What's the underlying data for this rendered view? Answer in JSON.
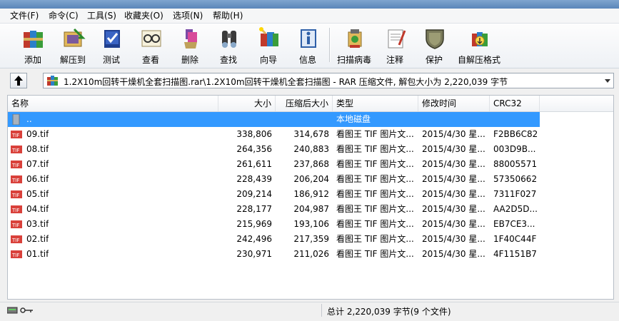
{
  "menu": [
    "文件(F)",
    "命令(C)",
    "工具(S)",
    "收藏夹(O)",
    "选项(N)",
    "帮助(H)"
  ],
  "toolbar": [
    {
      "label": "添加",
      "icon": "books-add-icon"
    },
    {
      "label": "解压到",
      "icon": "folder-extract-icon"
    },
    {
      "label": "测试",
      "icon": "test-book-icon"
    },
    {
      "label": "查看",
      "icon": "glasses-view-icon"
    },
    {
      "label": "删除",
      "icon": "recycle-delete-icon"
    },
    {
      "label": "查找",
      "icon": "binoculars-find-icon"
    },
    {
      "label": "向导",
      "icon": "wizard-icon"
    },
    {
      "label": "信息",
      "icon": "info-icon"
    },
    {
      "label": "扫描病毒",
      "icon": "virus-scan-icon"
    },
    {
      "label": "注释",
      "icon": "comment-icon"
    },
    {
      "label": "保护",
      "icon": "shield-protect-icon"
    },
    {
      "label": "自解压格式",
      "icon": "sfx-icon"
    }
  ],
  "address": "1.2X10m回转干燥机全套扫描图.rar\\1.2X10m回转干燥机全套扫描图 - RAR 压缩文件, 解包大小为 2,220,039 字节",
  "columns": {
    "name": "名称",
    "size": "大小",
    "packed": "压缩后大小",
    "type": "类型",
    "modified": "修改时间",
    "crc": "CRC32"
  },
  "parent_row": {
    "name": "..",
    "type": "本地磁盘"
  },
  "files": [
    {
      "name": "09.tif",
      "size": "338,806",
      "packed": "314,678",
      "type": "看图王 TIF 图片文...",
      "modified": "2015/4/30 星...",
      "crc": "F2BB6C82"
    },
    {
      "name": "08.tif",
      "size": "264,356",
      "packed": "240,883",
      "type": "看图王 TIF 图片文...",
      "modified": "2015/4/30 星...",
      "crc": "003D9B..."
    },
    {
      "name": "07.tif",
      "size": "261,611",
      "packed": "237,868",
      "type": "看图王 TIF 图片文...",
      "modified": "2015/4/30 星...",
      "crc": "88005571"
    },
    {
      "name": "06.tif",
      "size": "228,439",
      "packed": "206,204",
      "type": "看图王 TIF 图片文...",
      "modified": "2015/4/30 星...",
      "crc": "57350662"
    },
    {
      "name": "05.tif",
      "size": "209,214",
      "packed": "186,912",
      "type": "看图王 TIF 图片文...",
      "modified": "2015/4/30 星...",
      "crc": "7311F027"
    },
    {
      "name": "04.tif",
      "size": "228,177",
      "packed": "204,987",
      "type": "看图王 TIF 图片文...",
      "modified": "2015/4/30 星...",
      "crc": "AA2D5D..."
    },
    {
      "name": "03.tif",
      "size": "215,969",
      "packed": "193,106",
      "type": "看图王 TIF 图片文...",
      "modified": "2015/4/30 星...",
      "crc": "EB7CE3..."
    },
    {
      "name": "02.tif",
      "size": "242,496",
      "packed": "217,359",
      "type": "看图王 TIF 图片文...",
      "modified": "2015/4/30 星...",
      "crc": "1F40C44F"
    },
    {
      "name": "01.tif",
      "size": "230,971",
      "packed": "211,026",
      "type": "看图王 TIF 图片文...",
      "modified": "2015/4/30 星...",
      "crc": "4F1151B7"
    }
  ],
  "status": "总计 2,220,039 字节(9 个文件)"
}
